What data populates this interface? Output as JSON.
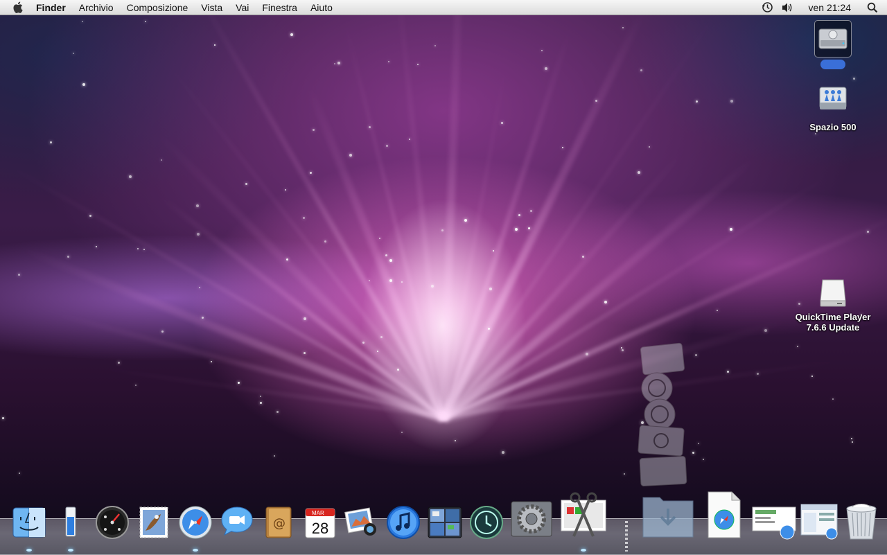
{
  "menubar": {
    "app": "Finder",
    "menus": [
      "Archivio",
      "Composizione",
      "Vista",
      "Vai",
      "Finestra",
      "Aiuto"
    ],
    "clock": "ven 21:24"
  },
  "desktop_icons": {
    "hard_disk": {
      "label": ""
    },
    "network": {
      "label": "Spazio 500"
    },
    "update_dmg": {
      "label": "QuickTime Player 7.6.6 Update"
    }
  },
  "dock": {
    "items": [
      {
        "name": "finder",
        "icon": "finder-icon",
        "running": true
      },
      {
        "name": "system-monitor",
        "icon": "thermometer-icon",
        "running": true
      },
      {
        "name": "dashboard",
        "icon": "dashboard-icon",
        "running": false
      },
      {
        "name": "mail",
        "icon": "mail-stamp-icon",
        "running": false
      },
      {
        "name": "safari",
        "icon": "compass-icon",
        "running": true
      },
      {
        "name": "ichat",
        "icon": "video-chat-icon",
        "running": false
      },
      {
        "name": "address-book",
        "icon": "address-book-icon",
        "running": false
      },
      {
        "name": "ical",
        "icon": "calendar-icon",
        "running": false
      },
      {
        "name": "iphoto",
        "icon": "photo-icon",
        "running": false
      },
      {
        "name": "itunes",
        "icon": "music-note-icon",
        "running": false
      },
      {
        "name": "spaces",
        "icon": "spaces-grid-icon",
        "running": false
      },
      {
        "name": "time-machine",
        "icon": "time-machine-icon",
        "running": false
      },
      {
        "name": "system-preferences",
        "icon": "gear-icon",
        "running": false
      },
      {
        "name": "grab",
        "icon": "scissors-icon",
        "running": true
      },
      {
        "name": "downloads",
        "icon": "download-folder-icon",
        "running": false
      },
      {
        "name": "documents",
        "icon": "document-icon",
        "running": false
      },
      {
        "name": "web-document",
        "icon": "web-document-icon",
        "running": false
      },
      {
        "name": "browser-stack",
        "icon": "browser-stack-icon",
        "running": false
      },
      {
        "name": "trash",
        "icon": "trash-icon",
        "running": false
      }
    ],
    "calendar": {
      "month": "MAR",
      "day": "28"
    }
  },
  "colors": {
    "menubar_top": "#f6f6f6",
    "menubar_bottom": "#dcdcdc",
    "wallpaper_glow": "#f07ad8",
    "running_indicator": "#bfe8ff"
  }
}
